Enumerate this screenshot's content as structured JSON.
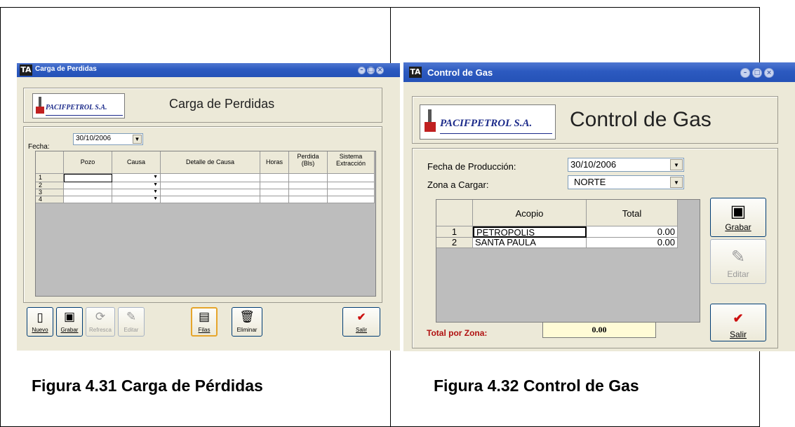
{
  "left_window": {
    "title": "Carga de Perdidas",
    "logo_text": "PACIFPETROL S.A.",
    "heading": "Carga de Perdidas",
    "fecha_label": "Fecha:",
    "fecha_value": "30/10/2006",
    "columns": [
      "Pozo",
      "Causa",
      "Detalle de Causa",
      "Horas",
      "Perdida (Bls)",
      "Sistema Extracción"
    ],
    "rows": [
      "1",
      "2",
      "3",
      "4"
    ],
    "buttons": [
      {
        "icon": "new-icon",
        "label": "Nuevo"
      },
      {
        "icon": "save-icon",
        "label": "Grabar"
      },
      {
        "icon": "refresh-icon",
        "label": "Refresca"
      },
      {
        "icon": "edit-icon",
        "label": "Editar"
      },
      {
        "icon": "rows-icon",
        "label": "Filas"
      },
      {
        "icon": "delete-icon",
        "label": "Eliminar"
      },
      {
        "icon": "exit-icon",
        "label": "Salir"
      }
    ],
    "caption": "Figura 4.31 Carga de Pérdidas"
  },
  "right_window": {
    "title": "Control de Gas",
    "logo_text": "PACIFPETROL S.A.",
    "heading": "Control de Gas",
    "fecha_label": "Fecha de Producción:",
    "fecha_value": "30/10/2006",
    "zona_label": "Zona a Cargar:",
    "zona_value": "NORTE",
    "columns": [
      "Acopio",
      "Total"
    ],
    "rows": [
      {
        "n": "1",
        "acopio": "PETROPOLIS",
        "total": "0.00"
      },
      {
        "n": "2",
        "acopio": "SANTA PAULA",
        "total": "0.00"
      }
    ],
    "buttons": [
      {
        "icon": "save-icon",
        "label": "Grabar"
      },
      {
        "icon": "edit-icon",
        "label": "Editar"
      },
      {
        "icon": "exit-icon",
        "label": "Salir"
      }
    ],
    "total_label": "Total por Zona:",
    "total_value": "0.00",
    "caption": "Figura 4.32 Control de Gas"
  },
  "colors": {
    "titlebar": "#2c5ac0",
    "window_bg": "#ece9d8",
    "total_label": "#b01010",
    "total_box": "#fffbd6",
    "exit_check": "#cc1010"
  }
}
